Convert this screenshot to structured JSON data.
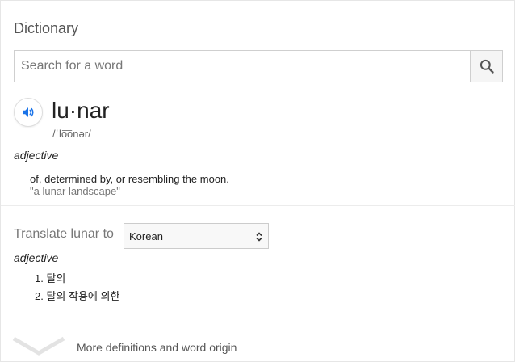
{
  "header": {
    "title": "Dictionary"
  },
  "search": {
    "placeholder": "Search for a word",
    "value": "",
    "icon": "search-icon"
  },
  "entry": {
    "word": "lu·nar",
    "phonetic": "/ˈlo͞onər/",
    "speaker_icon": "speaker-icon",
    "part_of_speech": "adjective",
    "definition": "of, determined by, or resembling the moon.",
    "example": "\"a lunar landscape\""
  },
  "translate": {
    "label": "Translate lunar to",
    "language": "Korean",
    "part_of_speech": "adjective",
    "items": [
      {
        "num": "1.",
        "text": "달의"
      },
      {
        "num": "2.",
        "text": "달의 작용에 의한"
      }
    ]
  },
  "footer": {
    "more_label": "More definitions and word origin",
    "icon": "chevron-down-icon"
  },
  "colors": {
    "accent": "#1a73e8",
    "muted_text": "#777777",
    "border": "#cfcfcf"
  }
}
